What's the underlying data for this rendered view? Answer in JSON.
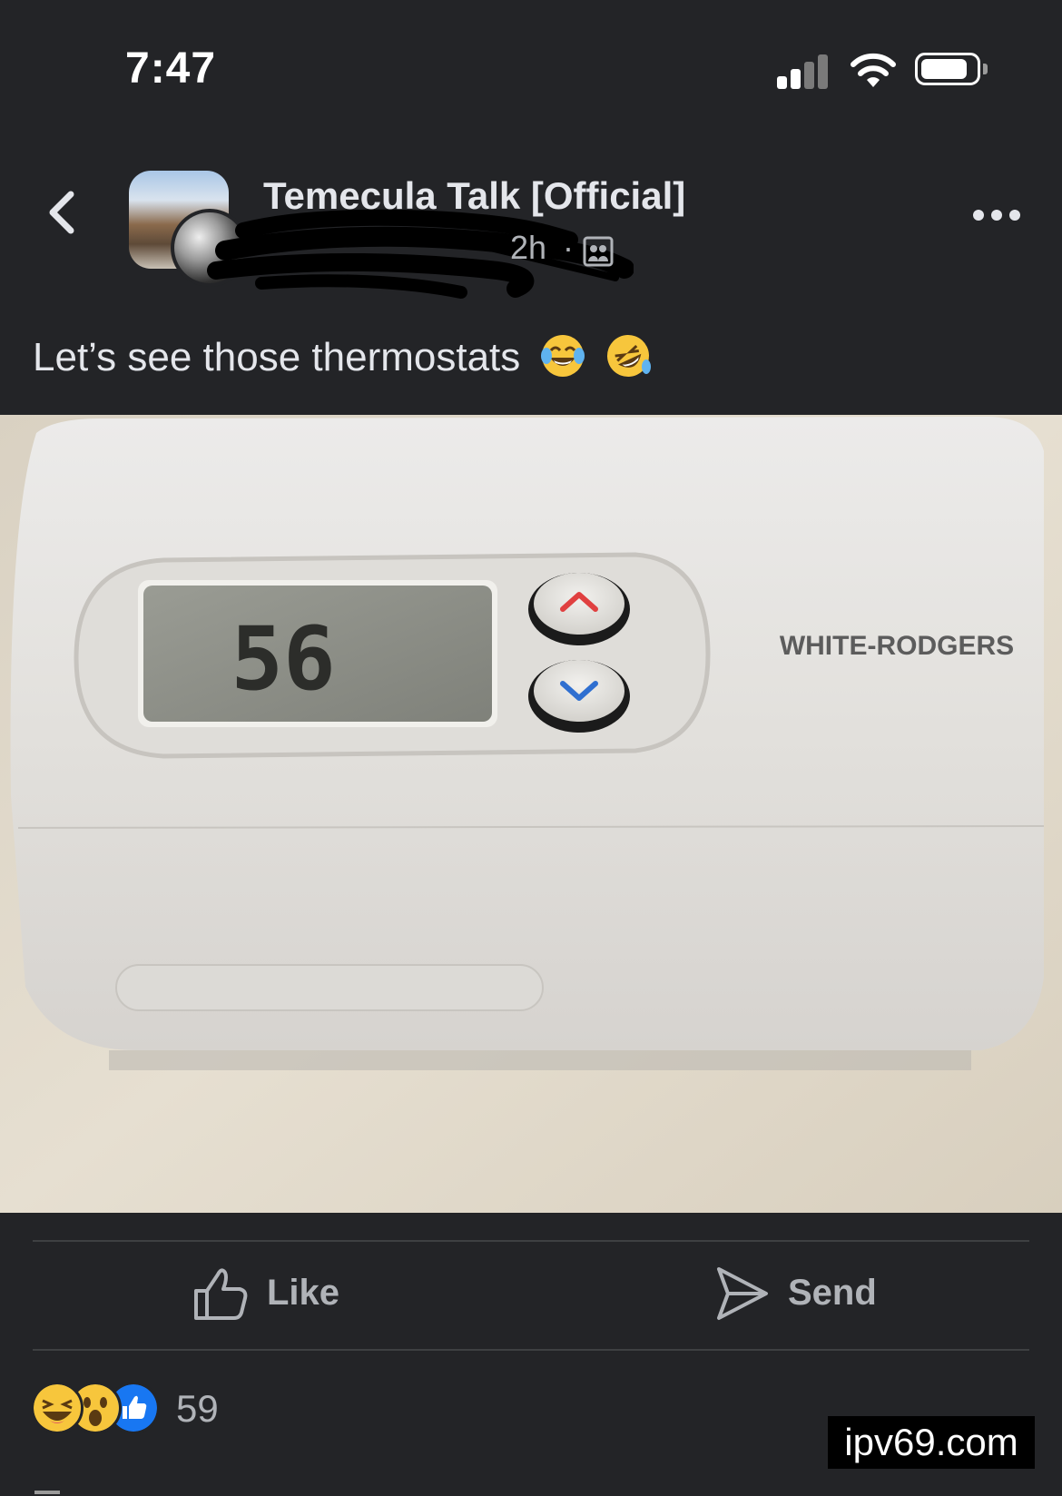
{
  "status_bar": {
    "time": "7:47",
    "icons": [
      "signal-icon",
      "wifi-icon",
      "battery-icon"
    ]
  },
  "header": {
    "group_name": "Temecula Talk [Official]",
    "author_name": "",
    "post_time": "2h",
    "separator": "·",
    "icons": [
      "back-chevron-icon",
      "group-audience-icon",
      "more-dots-icon"
    ]
  },
  "post": {
    "caption": "Let’s see those thermostats",
    "caption_emojis": [
      "face-with-tears-of-joy",
      "rolling-on-the-floor-laughing"
    ],
    "photo": {
      "display_value": "56",
      "brand": "WHITE-RODGERS",
      "icons": [
        "up-arrow-icon",
        "down-arrow-icon"
      ]
    }
  },
  "actions": {
    "like_label": "Like",
    "send_label": "Send"
  },
  "reactions": {
    "types": [
      "haha",
      "wow",
      "like"
    ],
    "count": "59"
  },
  "watermark": "ipv69.com",
  "colors": {
    "background": "#232427",
    "text_primary": "#e4e6eb",
    "text_secondary": "#b0b3b8",
    "like_blue": "#1877f2"
  }
}
